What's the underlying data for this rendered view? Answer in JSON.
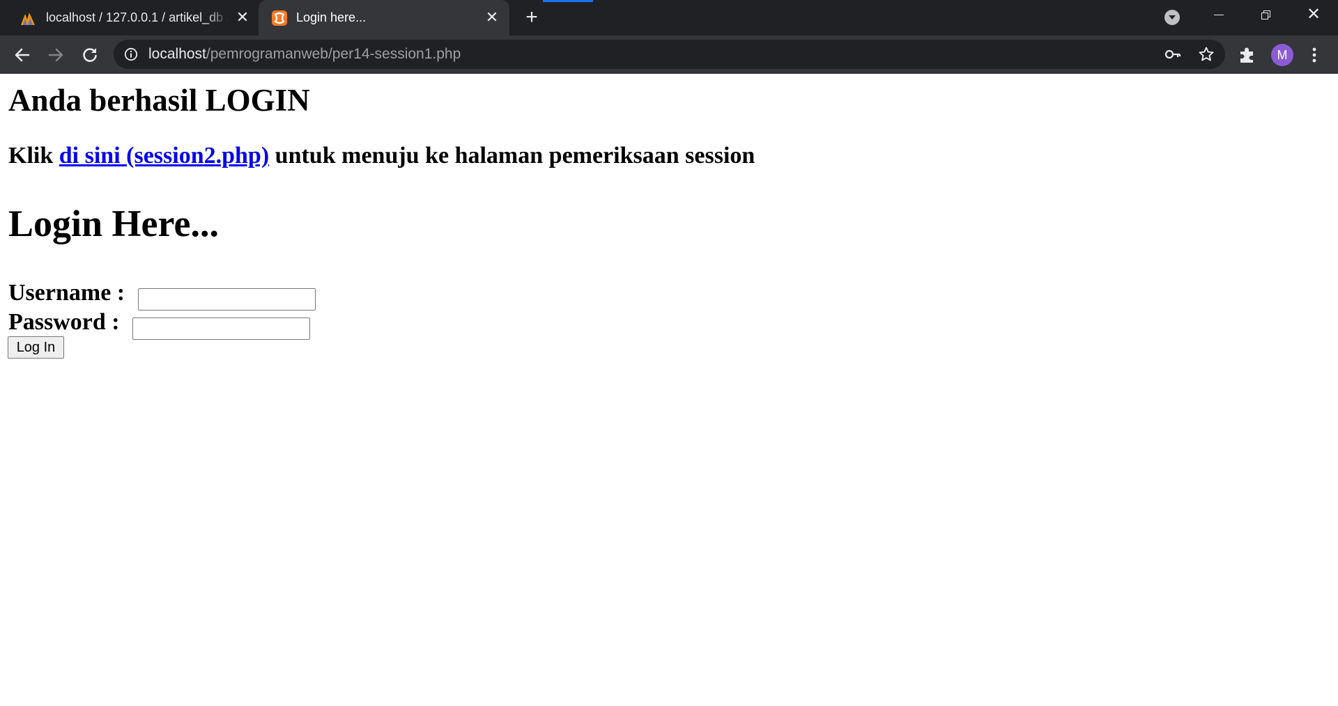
{
  "browser": {
    "tabs": [
      {
        "title": "localhost / 127.0.0.1 / artikel_db / ",
        "icon": "phpmyadmin-icon",
        "active": false
      },
      {
        "title": "Login here...",
        "icon": "xampp-icon",
        "active": true
      }
    ],
    "address_bar": {
      "host": "localhost",
      "path": "/pemrogramanweb/per14-session1.php"
    },
    "profile_initial": "M",
    "accent_color": "#1a73e8",
    "avatar_color": "#8b5cd6"
  },
  "page": {
    "success_heading": "Anda berhasil LOGIN",
    "klik_prefix": "Klik ",
    "klik_link": "di sini (session2.php)",
    "klik_suffix": " untuk menuju ke halaman pemeriksaan session",
    "login_heading": "Login Here...",
    "form": {
      "username_label": "Username : ",
      "username_value": "",
      "password_label": "Password : ",
      "password_value": "",
      "submit_label": "Log In"
    },
    "link_color": "#0000ee"
  }
}
